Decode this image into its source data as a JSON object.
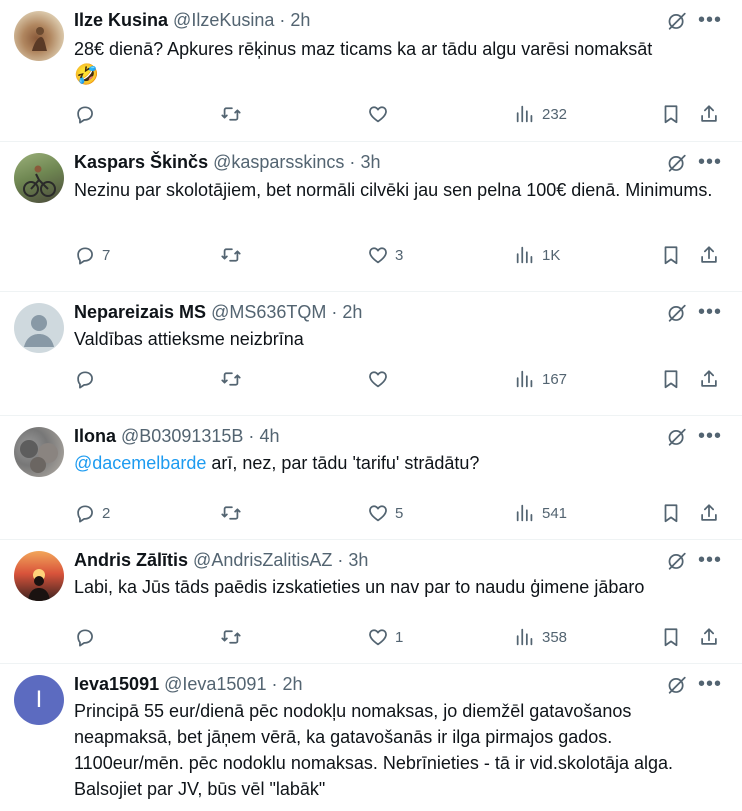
{
  "colors": {
    "text": "#0f1419",
    "muted": "#536471",
    "link": "#1d9bf0",
    "divider": "#eff3f4"
  },
  "tweets": [
    {
      "name": "Ilze Kusina",
      "handle": "@IlzeKusina",
      "dot": "·",
      "time": "2h",
      "text": "28€ dienā? Apkures rēķinus maz ticams ka ar tādu algu varēsi nomaksāt",
      "text_emoji": "🤣",
      "replies": "",
      "retweets": "",
      "likes": "",
      "views": "232"
    },
    {
      "name": "Kaspars Škinčs",
      "handle": "@kasparsskincs",
      "dot": "·",
      "time": "3h",
      "text": "Nezinu par skolotājiem, bet normāli cilvēki jau sen pelna 100€ dienā. Minimums.",
      "replies": "7",
      "retweets": "",
      "likes": "3",
      "views": "1K"
    },
    {
      "name": "Nepareizais MS",
      "handle": "@MS636TQM",
      "dot": "·",
      "time": "2h",
      "text": "Valdības attieksme neizbrīna",
      "replies": "",
      "retweets": "",
      "likes": "",
      "views": "167"
    },
    {
      "name": "Ilona",
      "handle": "@B03091315B",
      "dot": "·",
      "time": "4h",
      "mention": "@dacemelbarde",
      "text": " arī, nez, par tādu 'tarifu' strādātu?",
      "replies": "2",
      "retweets": "",
      "likes": "5",
      "views": "541"
    },
    {
      "name": "Andris Zālītis",
      "handle": "@AndrisZalitisAZ",
      "dot": "·",
      "time": "3h",
      "text": "Labi, ka Jūs tāds paēdis izskatieties un nav par to naudu ģimene jābaro",
      "replies": "",
      "retweets": "",
      "likes": "1",
      "views": "358"
    },
    {
      "name": "Ieva15091",
      "handle": "@Ieva15091",
      "dot": "·",
      "time": "2h",
      "avatar_letter": "I",
      "text": "Principā 55 eur/dienā pēc nodokļu nomaksas, jo diemžēl gatavošanos neapmaksā, bet jāņem vērā, ka gatavošanās ir ilga pirmajos gados. 1100eur/mēn. pēc nodoklu nomaksas. Nebrīnieties - tā ir vid.skolotāja alga. Balsojiet par JV, būs vēl \"labāk\""
    }
  ],
  "icons": {
    "reply": "reply-icon",
    "retweet": "retweet-icon",
    "like": "heart-icon",
    "views": "views-icon",
    "bookmark": "bookmark-icon",
    "share": "share-icon",
    "grok": "grok-icon",
    "more": "more-icon"
  }
}
